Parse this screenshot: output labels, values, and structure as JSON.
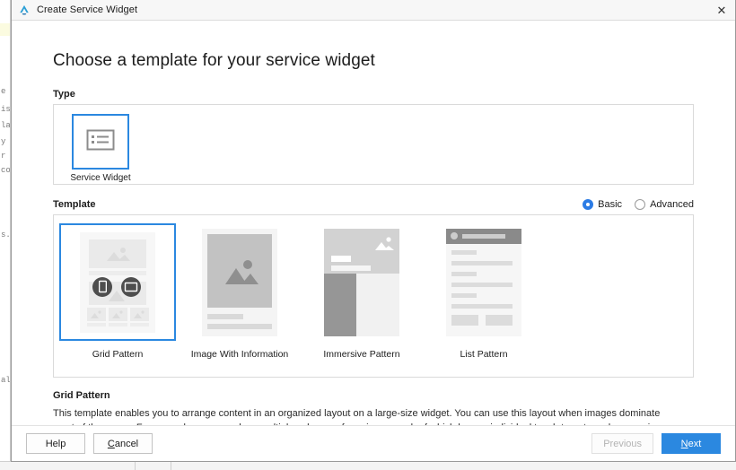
{
  "window": {
    "title": "Create Service Widget",
    "app_icon": "harmony-logo-icon",
    "close_label": "✕"
  },
  "heading": "Choose a template for your service widget",
  "type_section": {
    "label": "Type",
    "cards": [
      {
        "caption": "Service Widget",
        "icon": "list-layout-icon",
        "selected": true
      }
    ]
  },
  "template_section": {
    "label": "Template",
    "mode_options": [
      {
        "label": "Basic",
        "selected": true
      },
      {
        "label": "Advanced",
        "selected": false
      }
    ],
    "cards": [
      {
        "caption": "Grid Pattern",
        "selected": true
      },
      {
        "caption": "Image With Information",
        "selected": false
      },
      {
        "caption": "Immersive Pattern",
        "selected": false
      },
      {
        "caption": "List Pattern",
        "selected": false
      }
    ]
  },
  "description": {
    "title": "Grid Pattern",
    "body": "This template enables you to arrange content in an organized layout on a large-size widget. You can use this layout when images dominate most of the space. For example, you can show multiple columns of app icons, each of which has an individual touch target, or show movie and TV posters in a grid."
  },
  "footer": {
    "help": "Help",
    "cancel_mnemonic": "C",
    "cancel_rest": "ancel",
    "previous": "Previous",
    "next_mnemonic": "N",
    "next_rest": "ext"
  },
  "colors": {
    "accent": "#2b88e0",
    "panel_border": "#dadada",
    "titlebar_bg": "#f7f7f7",
    "thumb_bg": "#f4f4f4",
    "thumb_dark": "#9a9a9a",
    "thumb_circle": "#4e4e4e"
  },
  "background_fragments": [
    "e",
    "is",
    "la",
    "y",
    "r",
    "co",
    "s.",
    "al"
  ]
}
